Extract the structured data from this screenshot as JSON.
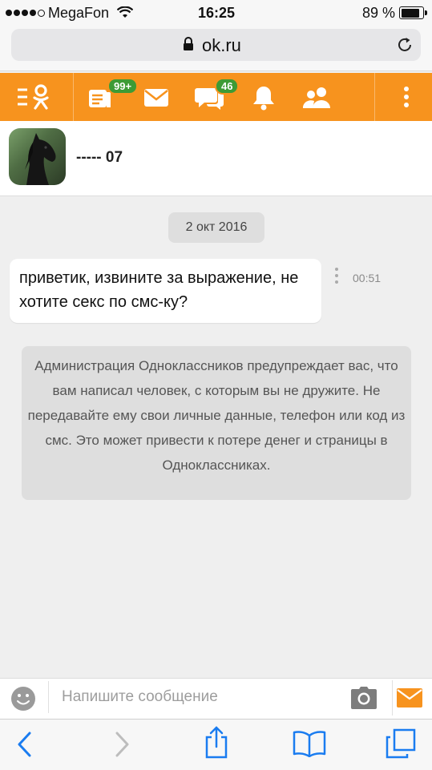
{
  "status_bar": {
    "carrier": "MegaFon",
    "time": "16:25",
    "battery": "89 %"
  },
  "browser": {
    "url": "ok.ru"
  },
  "toolbar": {
    "notes_badge": "99+",
    "discussions_badge": "46",
    "icons": [
      "ok-logo-icon",
      "notes-icon",
      "mail-icon",
      "discussions-icon",
      "bell-icon",
      "friends-icon",
      "more-icon"
    ],
    "accent_color": "#f7931e",
    "badge_color": "#3d9b35"
  },
  "chat": {
    "user_name": "----- 07",
    "date": "2 окт 2016",
    "message": "приветик, извините за выражение, не хотите секс по смс-ку?",
    "message_time": "00:51",
    "warning": "Администрация Одноклассников предупреждает вас, что вам написал человек, с которым вы не дружите. Не передавайте ему свои личные данные, телефон или код из смс. Это может привести к потере денег и страницы в Одноклассниках."
  },
  "composer": {
    "placeholder": "Напишите сообщение"
  }
}
